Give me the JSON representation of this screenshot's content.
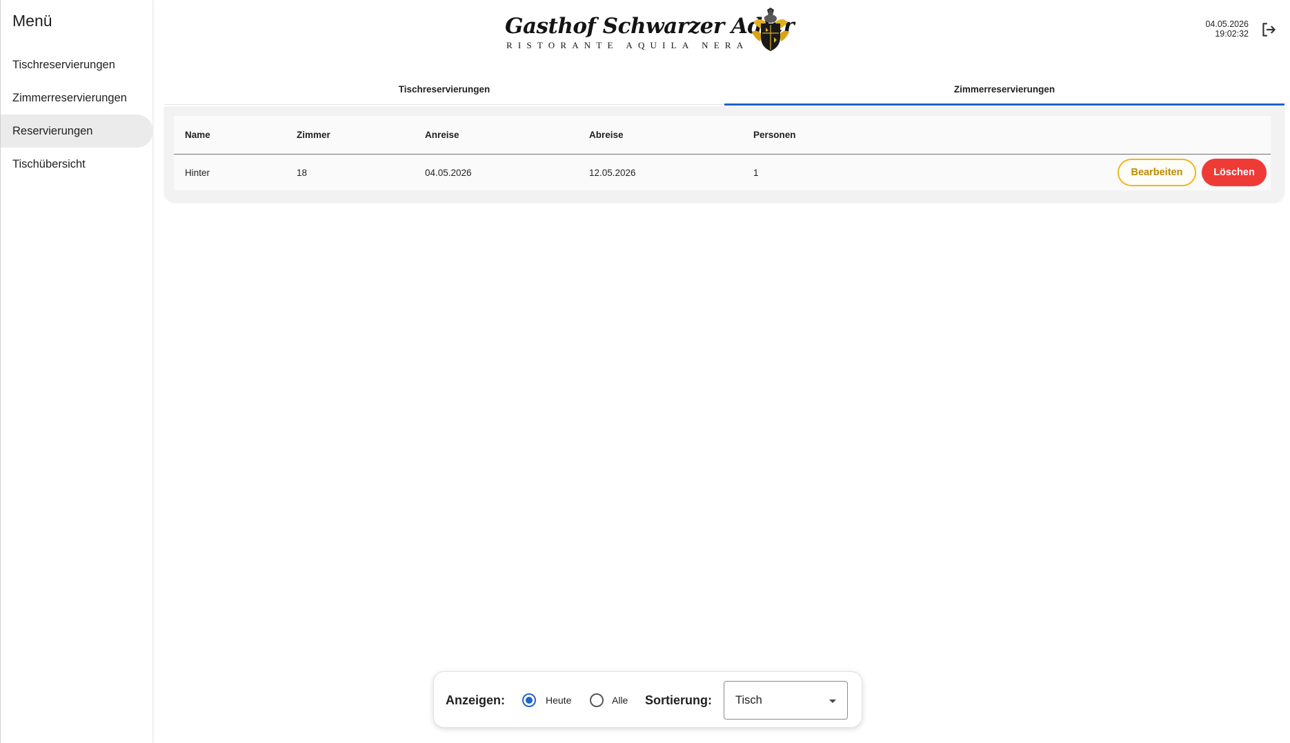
{
  "sidebar": {
    "title": "Menü",
    "items": [
      {
        "label": "Tischreservierungen",
        "active": false
      },
      {
        "label": "Zimmerreservierungen",
        "active": false
      },
      {
        "label": "Reservierungen",
        "active": true
      },
      {
        "label": "Tischübersicht",
        "active": false
      }
    ]
  },
  "header": {
    "logo_title": "Gasthof Schwarzer Adler",
    "logo_subtitle": "RISTORANTE AQUILA NERA",
    "date": "04.05.2026",
    "time": "19:02:32",
    "logout_icon": "logout-icon"
  },
  "tabs": [
    {
      "label": "Tischreservierungen",
      "active": false
    },
    {
      "label": "Zimmerreservierungen",
      "active": true
    }
  ],
  "table": {
    "columns": [
      "Name",
      "Zimmer",
      "Anreise",
      "Abreise",
      "Personen"
    ],
    "rows": [
      {
        "name": "Hinter",
        "zimmer": "18",
        "anreise": "04.05.2026",
        "abreise": "12.05.2026",
        "personen": "1"
      }
    ],
    "edit_label": "Bearbeiten",
    "delete_label": "Löschen"
  },
  "filter": {
    "show_label": "Anzeigen:",
    "options": [
      {
        "label": "Heute",
        "checked": true
      },
      {
        "label": "Alle",
        "checked": false
      }
    ],
    "sort_label": "Sortierung:",
    "sort_value": "Tisch"
  },
  "colors": {
    "accent": "#1e63c9",
    "edit_border": "#f2b51a",
    "delete_bg": "#ef3b36"
  }
}
